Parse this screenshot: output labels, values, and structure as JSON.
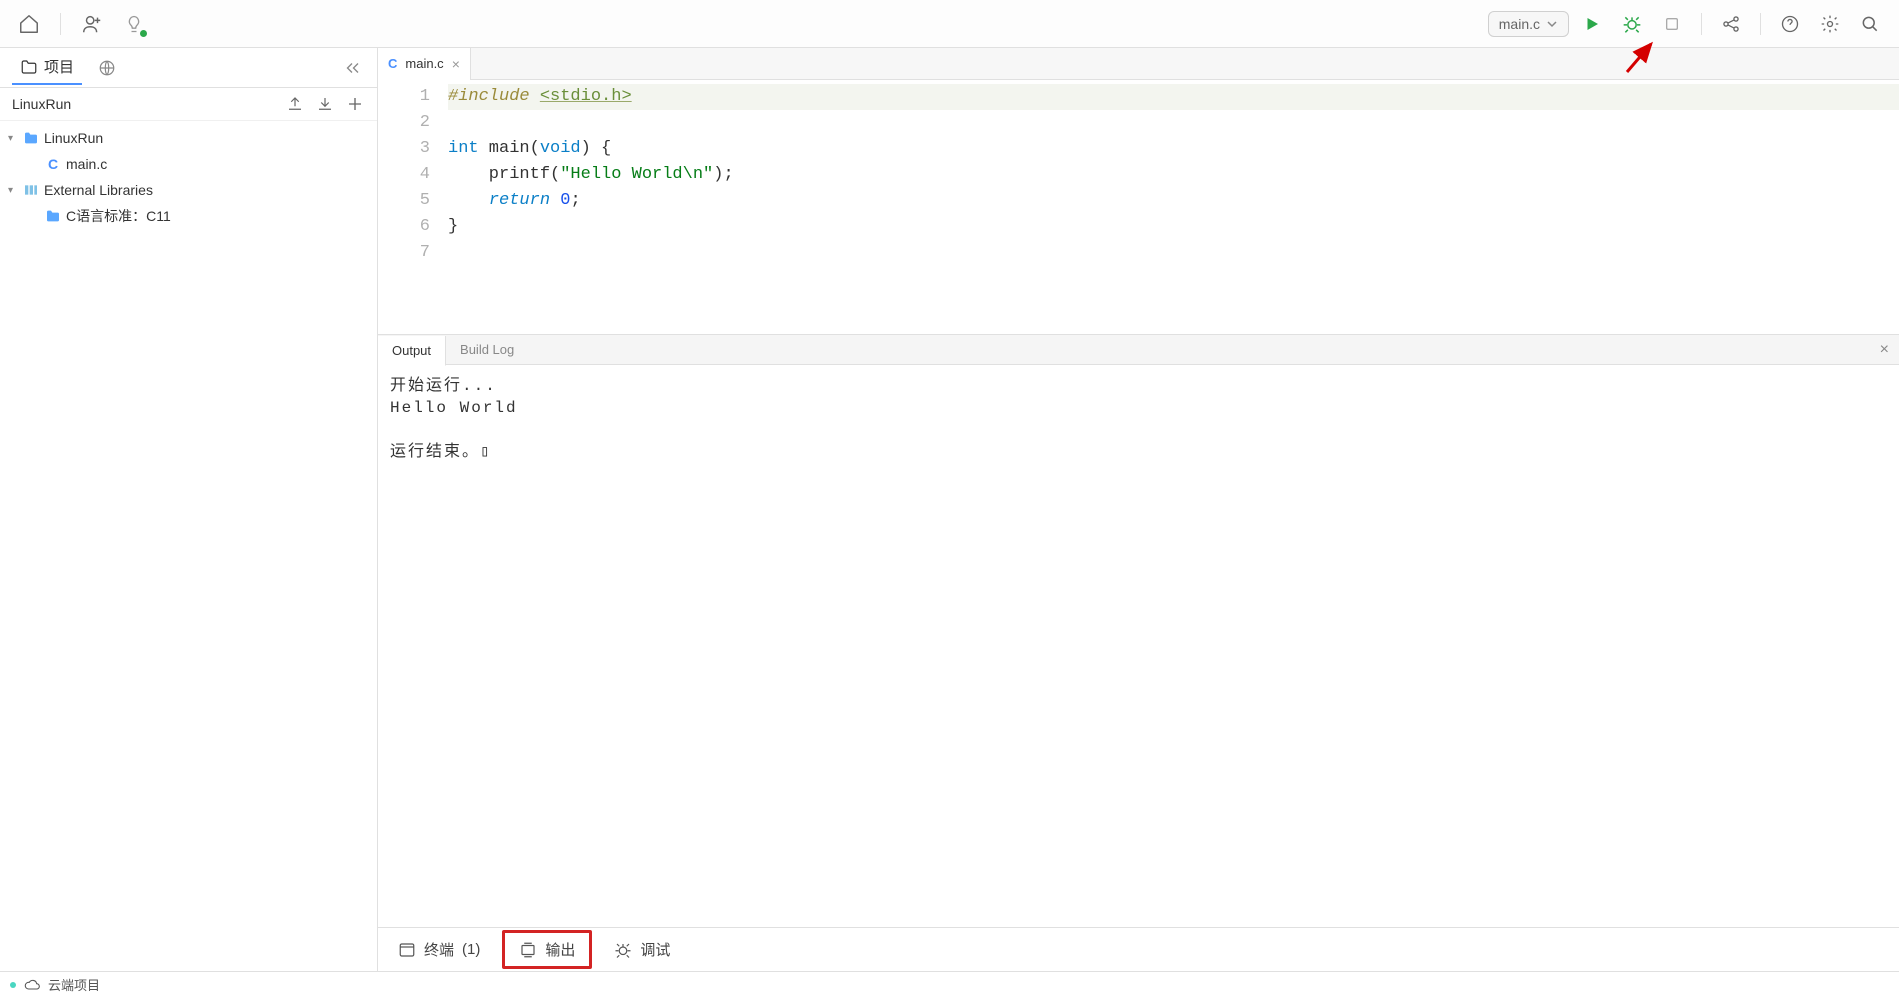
{
  "topbar": {
    "run_target": "main.c"
  },
  "sidebar": {
    "tabs": {
      "project": "项目"
    },
    "project_name": "LinuxRun",
    "tree": {
      "root": "LinuxRun",
      "file0": "main.c",
      "ext_libs": "External Libraries",
      "c_std": "C语言标准：C11"
    }
  },
  "editor": {
    "tab": {
      "file": "main.c"
    },
    "lines": [
      "1",
      "2",
      "3",
      "4",
      "5",
      "6",
      "7"
    ],
    "code": {
      "l1a": "#include ",
      "l1b": "<stdio.h>",
      "l3a": "int",
      "l3b": " main(",
      "l3c": "void",
      "l3d": ") {",
      "l4a": "    printf(",
      "l4b": "\"Hello World\\n\"",
      "l4c": ");",
      "l5a": "    ",
      "l5b": "return",
      "l5c": " ",
      "l5d": "0",
      "l5e": ";",
      "l6": "}"
    }
  },
  "panel": {
    "tabs": {
      "output": "Output",
      "buildlog": "Build Log"
    },
    "output": "开始运行...\nHello World\n\n运行结束。▯"
  },
  "bottombar": {
    "terminal": "终端",
    "terminal_count": "(1)",
    "output": "输出",
    "debug": "调试"
  },
  "status": {
    "cloud": "云端项目"
  }
}
